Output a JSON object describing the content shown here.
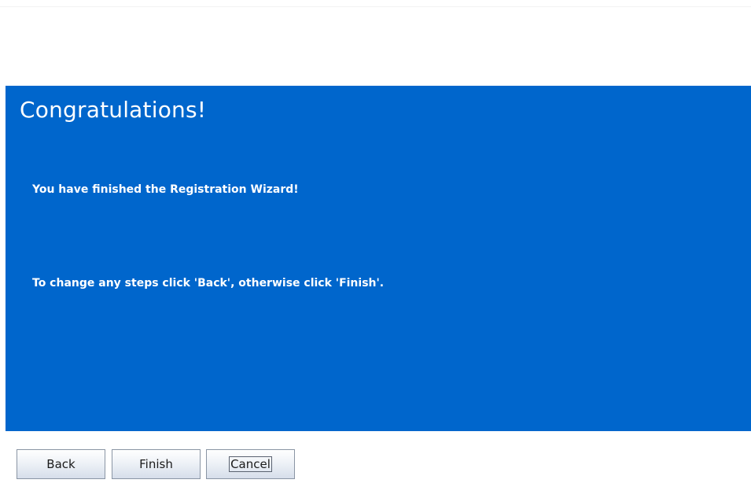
{
  "wizard": {
    "title": "Congratulations!",
    "finished_message": "You have finished the Registration Wizard!",
    "instructions": "To change any steps click 'Back', otherwise click 'Finish'.",
    "panel_color": "#0066cc"
  },
  "buttons": {
    "back": "Back",
    "finish": "Finish",
    "cancel": "Cancel",
    "focused": "cancel"
  }
}
